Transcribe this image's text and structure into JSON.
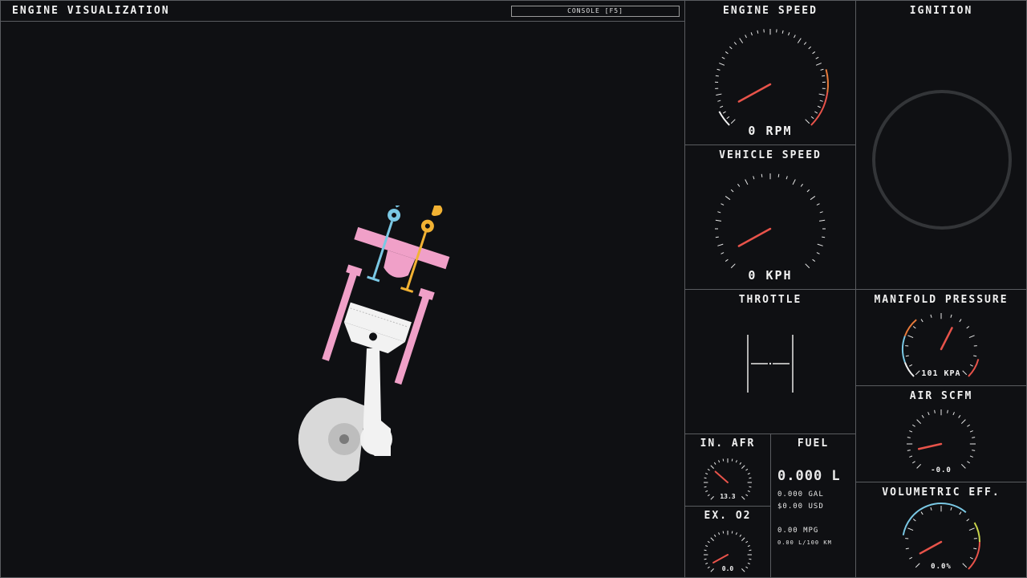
{
  "header": {
    "title": "ENGINE VISUALIZATION",
    "console_label": "CONSOLE [F5]"
  },
  "panels": {
    "engine_speed": {
      "title": "ENGINE SPEED",
      "value": 0,
      "unit": "RPM",
      "display": "0 RPM"
    },
    "vehicle_speed": {
      "title": "VEHICLE SPEED",
      "value": 0,
      "unit": "KPH",
      "display": "0 KPH"
    },
    "ignition": {
      "title": "IGNITION"
    },
    "throttle": {
      "title": "THROTTLE"
    },
    "manifold_pressure": {
      "title": "MANIFOLD PRESSURE",
      "value": 101,
      "unit": "KPA",
      "display": "101 KPA"
    },
    "air_scfm": {
      "title": "AIR SCFM",
      "value": -0.0,
      "display": "-0.0"
    },
    "in_afr": {
      "title": "IN. AFR",
      "value": 13.3,
      "display": "13.3"
    },
    "ex_o2": {
      "title": "EX. O2",
      "value": 0.0,
      "display": "0.0"
    },
    "fuel": {
      "title": "FUEL",
      "liters": "0.000 L",
      "gallons": "0.000 GAL",
      "cost": "$0.00 USD",
      "mpg": "0.00 MPG",
      "l_per_100km": "0.00 L/100 KM"
    },
    "volumetric_eff": {
      "title": "VOLUMETRIC EFF.",
      "value": 0.0,
      "display": "0.0%"
    }
  },
  "colors": {
    "background": "#0f1013",
    "panel_border": "#5a5c60",
    "needle": "#e8534a",
    "redline": "#e8534a",
    "warn_orange": "#e87a3a",
    "cool_blue": "#7ac8e4",
    "yellow_green": "#c9d44a",
    "piston_pink": "#f0a0c8",
    "intake_cam": "#7ac8e4",
    "exhaust_cam": "#f2b233",
    "piston_white": "#f2f2f2",
    "crank_gray": "#d8d8d8"
  }
}
